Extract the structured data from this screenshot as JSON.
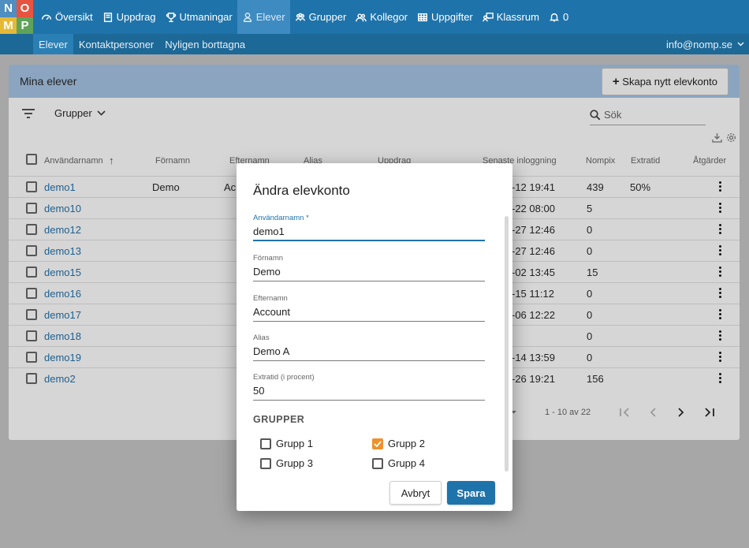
{
  "logo": {
    "letters": [
      "N",
      "O",
      "M",
      "P"
    ]
  },
  "nav": {
    "items": [
      {
        "label": "Översikt",
        "icon": "dashboard-icon"
      },
      {
        "label": "Uppdrag",
        "icon": "book-icon"
      },
      {
        "label": "Utmaningar",
        "icon": "trophy-icon"
      },
      {
        "label": "Elever",
        "icon": "user-icon"
      },
      {
        "label": "Grupper",
        "icon": "users-icon"
      },
      {
        "label": "Kollegor",
        "icon": "user-group-icon"
      },
      {
        "label": "Uppgifter",
        "icon": "grid-icon"
      },
      {
        "label": "Klassrum",
        "icon": "classroom-icon"
      }
    ],
    "notifications": {
      "count": "0",
      "icon": "bell-icon"
    },
    "active": "Elever"
  },
  "subnav": {
    "items": [
      "Elever",
      "Kontaktpersoner",
      "Nyligen borttagna"
    ],
    "user_email": "info@nomp.se"
  },
  "card": {
    "title": "Mina elever",
    "create_button": "Skapa nytt elevkonto"
  },
  "toolbar": {
    "groups_label": "Grupper",
    "search_placeholder": "Sök"
  },
  "table": {
    "columns": [
      "Användarnamn",
      "Förnamn",
      "Efternamn",
      "Alias",
      "Uppdrag",
      "Senaste inloggning",
      "Nompix",
      "Extratid",
      "Åtgärder"
    ],
    "rows": [
      {
        "username": "demo1",
        "first": "Demo",
        "last": "Ac",
        "login": "-12 19:41",
        "nompix": "439",
        "extra": "50%"
      },
      {
        "username": "demo10",
        "first": "",
        "last": "",
        "login": "-22 08:00",
        "nompix": "5",
        "extra": ""
      },
      {
        "username": "demo12",
        "first": "",
        "last": "",
        "login": "-27 12:46",
        "nompix": "0",
        "extra": ""
      },
      {
        "username": "demo13",
        "first": "",
        "last": "",
        "login": "-27 12:46",
        "nompix": "0",
        "extra": ""
      },
      {
        "username": "demo15",
        "first": "",
        "last": "",
        "login": "-02 13:45",
        "nompix": "15",
        "extra": ""
      },
      {
        "username": "demo16",
        "first": "",
        "last": "",
        "login": "-15 11:12",
        "nompix": "0",
        "extra": ""
      },
      {
        "username": "demo17",
        "first": "",
        "last": "",
        "login": "-06 12:22",
        "nompix": "0",
        "extra": ""
      },
      {
        "username": "demo18",
        "first": "",
        "last": "",
        "login": "",
        "nompix": "0",
        "extra": ""
      },
      {
        "username": "demo19",
        "first": "",
        "last": "",
        "login": "-14 13:59",
        "nompix": "0",
        "extra": ""
      },
      {
        "username": "demo2",
        "first": "",
        "last": "",
        "login": "-26 19:21",
        "nompix": "156",
        "extra": ""
      }
    ],
    "pagination": {
      "range": "1 - 10 av 22"
    }
  },
  "modal": {
    "title": "Ändra elevkonto",
    "fields": [
      {
        "label": "Användarnamn",
        "required": "*",
        "value": "demo1"
      },
      {
        "label": "Förnamn",
        "value": "Demo"
      },
      {
        "label": "Efternamn",
        "value": "Account"
      },
      {
        "label": "Alias",
        "value": "Demo A"
      },
      {
        "label": "Extratid (i procent)",
        "value": "50"
      }
    ],
    "groups_title": "GRUPPER",
    "groups": [
      {
        "label": "Grupp 1",
        "checked": false
      },
      {
        "label": "Grupp 2",
        "checked": true
      },
      {
        "label": "Grupp 3",
        "checked": false
      },
      {
        "label": "Grupp 4",
        "checked": false
      }
    ],
    "cancel": "Avbryt",
    "save": "Spara"
  },
  "colors": {
    "primary": "#1f73ab",
    "accent_checkbox": "#f0902a",
    "logo_n": "#4f8ec1",
    "logo_o": "#e6533f",
    "logo_m": "#e5b936",
    "logo_p": "#5fa35a"
  }
}
